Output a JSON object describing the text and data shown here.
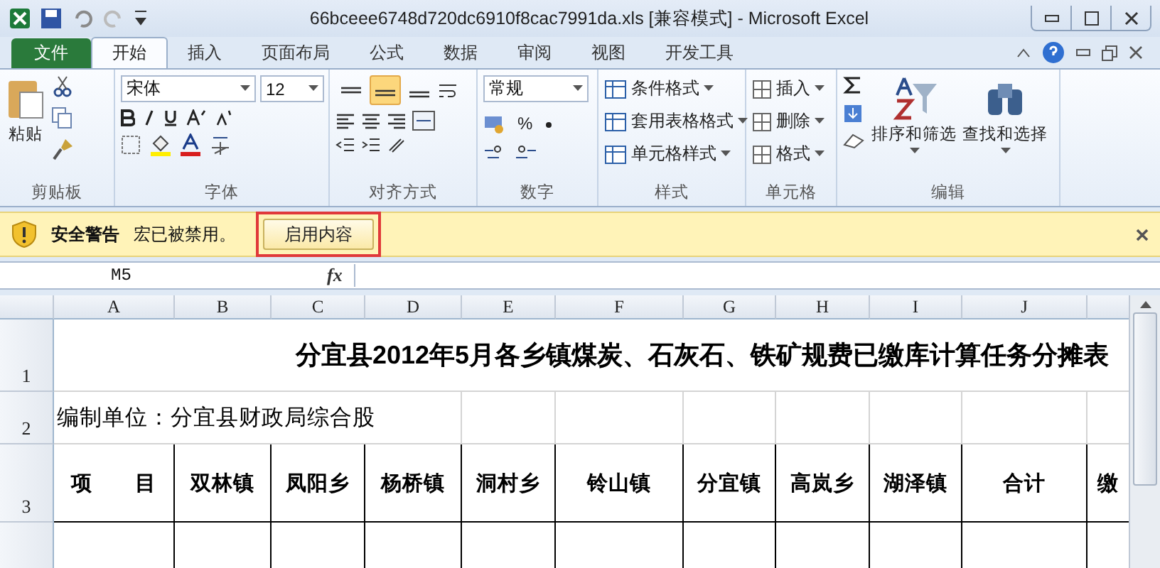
{
  "window": {
    "title": "66bceee6748d720dc6910f8cac7991da.xls  [兼容模式] - Microsoft Excel"
  },
  "tabs": [
    {
      "label": "文件",
      "kind": "file",
      "selected": false
    },
    {
      "label": "开始",
      "kind": "tab",
      "selected": true
    },
    {
      "label": "插入",
      "kind": "tab",
      "selected": false
    },
    {
      "label": "页面布局",
      "kind": "tab",
      "selected": false
    },
    {
      "label": "公式",
      "kind": "tab",
      "selected": false
    },
    {
      "label": "数据",
      "kind": "tab",
      "selected": false
    },
    {
      "label": "审阅",
      "kind": "tab",
      "selected": false
    },
    {
      "label": "视图",
      "kind": "tab",
      "selected": false
    },
    {
      "label": "开发工具",
      "kind": "tab",
      "selected": false
    }
  ],
  "ribbon": {
    "clipboard": {
      "paste": "粘贴",
      "label": "剪贴板"
    },
    "font": {
      "name": "宋体",
      "size": "12",
      "label": "字体"
    },
    "alignment": {
      "vertical": [
        {
          "selected": false
        },
        {
          "selected": true
        },
        {
          "selected": false
        }
      ],
      "label": "对齐方式"
    },
    "number": {
      "format": "常规",
      "percent": "%",
      "label": "数字"
    },
    "styles": {
      "items": [
        "条件格式",
        "套用表格格式",
        "单元格样式"
      ],
      "label": "样式"
    },
    "cells": {
      "items": [
        "插入",
        "删除",
        "格式"
      ],
      "label": "单元格"
    },
    "editing": {
      "sort": "排序和筛选",
      "find": "查找和选择",
      "label": "编辑"
    }
  },
  "security_bar": {
    "title": "安全警告",
    "message": "宏已被禁用。",
    "button": "启用内容",
    "highlighted": true
  },
  "formula_bar": {
    "name_box": "M5",
    "fx": "fx"
  },
  "sheet": {
    "columns": [
      "A",
      "B",
      "C",
      "D",
      "E",
      "F",
      "G",
      "H",
      "I",
      "J"
    ],
    "rows": [
      {
        "number": "1",
        "kind": "title",
        "text": "分宜县2012年5月各乡镇煤炭、石灰石、铁矿规费已缴库计算任务分摊表"
      },
      {
        "number": "2",
        "kind": "note",
        "text": "编制单位：分宜县财政局综合股"
      },
      {
        "number": "3",
        "kind": "header",
        "cells": [
          "项　　目",
          "双林镇",
          "凤阳乡",
          "杨桥镇",
          "洞村乡",
          "铃山镇",
          "分宜镇",
          "高岚乡",
          "湖泽镇",
          "合计",
          "缴"
        ]
      }
    ]
  }
}
